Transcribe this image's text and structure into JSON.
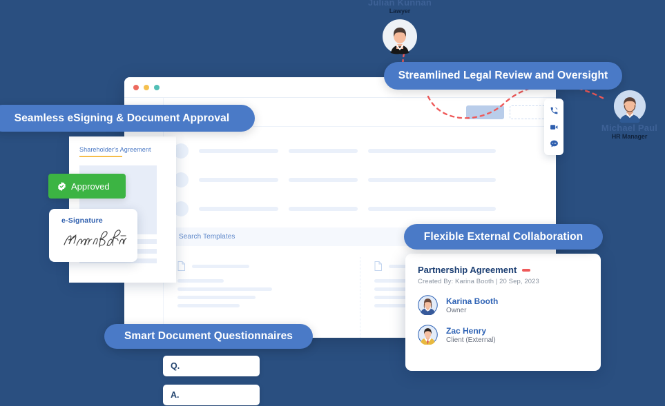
{
  "theme": {
    "background": "#2a4f80",
    "pill": "#4a7ac7",
    "accent_blue": "#2f63b5",
    "approved_green": "#3cb443",
    "red_dash": "#ef5a5a"
  },
  "pills": [
    {
      "id": "esign",
      "label": "Seamless eSigning & Document Approval"
    },
    {
      "id": "legal",
      "label": "Streamlined Legal Review and Oversight"
    },
    {
      "id": "collab",
      "label": "Flexible External Collaboration"
    },
    {
      "id": "quest",
      "label": "Smart Document Questionnaires"
    }
  ],
  "window": {
    "traffic_lights": [
      "red",
      "yellow",
      "teal"
    ],
    "search_placeholder": "Search Templates"
  },
  "document_card": {
    "title": "Shareholder's Agreement"
  },
  "approved_badge": {
    "label": "Approved",
    "icon": "check-seal-icon"
  },
  "esignature": {
    "label": "e-Signature",
    "signature_name": "Karina Booth"
  },
  "rail_icons": [
    "phone-icon",
    "video-camera-icon",
    "chat-bubble-icon"
  ],
  "partnership_card": {
    "title": "Partnership Agreement",
    "meta": "Created By: Karina Booth  |  20 Sep, 2023",
    "members": [
      {
        "name": "Karina Booth",
        "role": "Owner"
      },
      {
        "name": "Zac Henry",
        "role": "Client (External)"
      }
    ]
  },
  "personas": [
    {
      "id": "lawyer",
      "name": "Julian Kunnan",
      "role": "Lawyer"
    },
    {
      "id": "hr",
      "name": "Michael Paul",
      "role": "HR Manager"
    }
  ],
  "questionnaire": [
    {
      "id": "q",
      "label": "Q."
    },
    {
      "id": "a",
      "label": "A."
    }
  ]
}
